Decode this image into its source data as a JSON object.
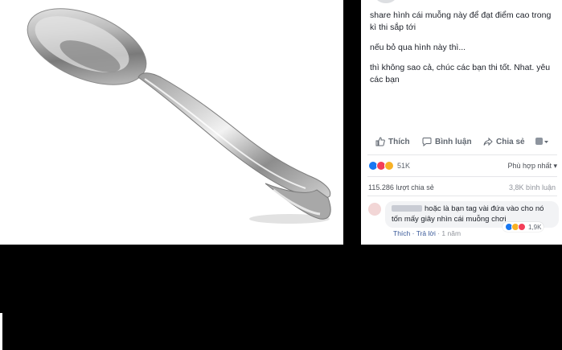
{
  "post": {
    "line1": "share hình cái muỗng này để đạt điểm cao trong kì thi sắp tới",
    "line2": "nếu bỏ qua hình này thì...",
    "line3": "thì không sao cả, chúc các bạn thi tốt. Nhat. yêu các bạn"
  },
  "actions": {
    "like_label": "Thích",
    "comment_label": "Bình luận",
    "share_label": "Chia sẻ"
  },
  "reactions": {
    "count": "51K",
    "sort_label": "Phù hợp nhất ▾"
  },
  "stats": {
    "shares": "115.286 lượt chia sẻ",
    "comments": "3,8K bình luận"
  },
  "comment": {
    "text": "hoặc là bạn tag vài đứa vào cho nó tốn mấy giây nhìn cái muỗng chơi",
    "reaction_count": "1,9K",
    "like_label": "Thích",
    "reply_label": "Trả lời",
    "time": "1 năm"
  },
  "colors": {
    "accent": "#385898",
    "like": "#1877f2",
    "love": "#f33e58",
    "haha": "#f7b125",
    "angry": "#e9710f"
  }
}
